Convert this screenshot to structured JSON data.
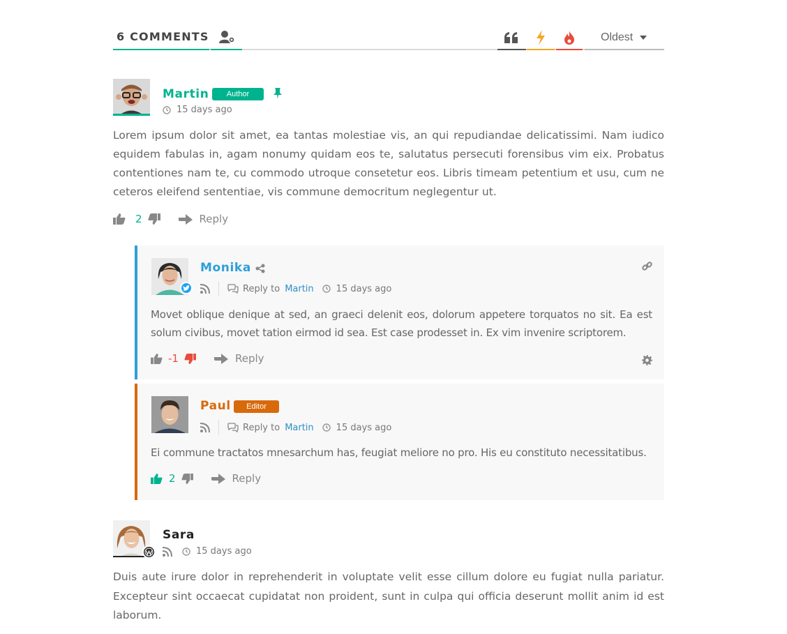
{
  "header": {
    "comments_count": "6 COMMENTS",
    "sort": "Oldest",
    "tabs": [
      {
        "icon": "quote-icon",
        "color": "#444444"
      },
      {
        "icon": "lightning-icon",
        "color": "#f5a623"
      },
      {
        "icon": "fire-icon",
        "color": "#e74c3c"
      }
    ]
  },
  "comments": [
    {
      "author": "Martin",
      "role": "Author",
      "name_color": "#00b38f",
      "role_color": "#00b38f",
      "time": "15 days ago",
      "text": "Lorem ipsum dolor sit amet, ea tantas molestiae vis, an qui repudiandae delicatissimi. Nam iudico equidem fabulas in, agam nonumy quidam eos te, salutatus persecuti forensibus vim eix. Probatus contentiones nam te, cu commodo utroque consetetur eos. Libris timeam petentium et usu, cum ne ceteros eleifend sententiae, vis commune democritum neglegentur ut.",
      "votes": "2",
      "reply": "Reply",
      "pinned": true
    },
    {
      "author": "Monika",
      "name_color": "#2e9fd8",
      "reply_to_label": "Reply to",
      "reply_to": "Martin",
      "time": "15 days ago",
      "text": "Movet oblique denique at sed, an graeci delenit eos, dolorum appetere torquatos no sit. Ea est solum civibus, movet tation eirmod id sea. Est case prodesset in. Ex vim invenire scriptorem.",
      "votes": "-1",
      "reply": "Reply",
      "border_color": "#2e9fd8"
    },
    {
      "author": "Paul",
      "role": "Editor",
      "name_color": "#d86a0c",
      "role_color": "#d86a0c",
      "reply_to_label": "Reply to",
      "reply_to": "Martin",
      "time": "15 days ago",
      "text": "Ei commune tractatos mnesarchum has, feugiat meliore no pro. His eu constituto necessitatibus.",
      "votes": "2",
      "reply": "Reply",
      "border_color": "#d86a0c"
    },
    {
      "author": "Sara",
      "name_color": "#222222",
      "time": "15 days ago",
      "text": "Duis aute irure dolor in reprehenderit in voluptate velit esse cillum dolore eu fugiat nulla pariatur. Excepteur sint occaecat cupidatat non proident, sunt in culpa qui officia deserunt mollit anim id est laborum."
    }
  ]
}
